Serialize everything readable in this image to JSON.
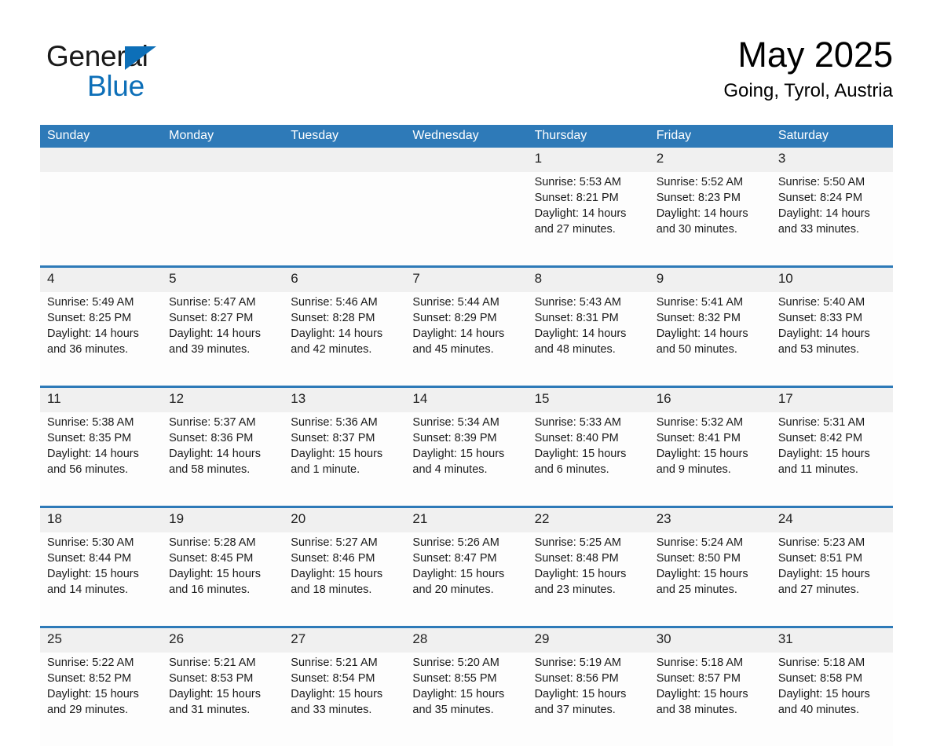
{
  "logo": {
    "word_dark": "General",
    "word_blue": "Blue",
    "triangle_color": "#0d6fb8"
  },
  "header": {
    "month_title": "May 2025",
    "location": "Going, Tyrol, Austria"
  },
  "theme": {
    "header_blue": "#2e7ab8",
    "row_divider_blue": "#2e7ab8",
    "daynum_band": "#f0f0f0",
    "cell_background": "#fdfdfd"
  },
  "calendar": {
    "weekday_headers": [
      "Sunday",
      "Monday",
      "Tuesday",
      "Wednesday",
      "Thursday",
      "Friday",
      "Saturday"
    ],
    "weeks": [
      [
        {
          "day": "",
          "lines": []
        },
        {
          "day": "",
          "lines": []
        },
        {
          "day": "",
          "lines": []
        },
        {
          "day": "",
          "lines": []
        },
        {
          "day": "1",
          "lines": [
            "Sunrise: 5:53 AM",
            "Sunset: 8:21 PM",
            "Daylight: 14 hours",
            "and 27 minutes."
          ]
        },
        {
          "day": "2",
          "lines": [
            "Sunrise: 5:52 AM",
            "Sunset: 8:23 PM",
            "Daylight: 14 hours",
            "and 30 minutes."
          ]
        },
        {
          "day": "3",
          "lines": [
            "Sunrise: 5:50 AM",
            "Sunset: 8:24 PM",
            "Daylight: 14 hours",
            "and 33 minutes."
          ]
        }
      ],
      [
        {
          "day": "4",
          "lines": [
            "Sunrise: 5:49 AM",
            "Sunset: 8:25 PM",
            "Daylight: 14 hours",
            "and 36 minutes."
          ]
        },
        {
          "day": "5",
          "lines": [
            "Sunrise: 5:47 AM",
            "Sunset: 8:27 PM",
            "Daylight: 14 hours",
            "and 39 minutes."
          ]
        },
        {
          "day": "6",
          "lines": [
            "Sunrise: 5:46 AM",
            "Sunset: 8:28 PM",
            "Daylight: 14 hours",
            "and 42 minutes."
          ]
        },
        {
          "day": "7",
          "lines": [
            "Sunrise: 5:44 AM",
            "Sunset: 8:29 PM",
            "Daylight: 14 hours",
            "and 45 minutes."
          ]
        },
        {
          "day": "8",
          "lines": [
            "Sunrise: 5:43 AM",
            "Sunset: 8:31 PM",
            "Daylight: 14 hours",
            "and 48 minutes."
          ]
        },
        {
          "day": "9",
          "lines": [
            "Sunrise: 5:41 AM",
            "Sunset: 8:32 PM",
            "Daylight: 14 hours",
            "and 50 minutes."
          ]
        },
        {
          "day": "10",
          "lines": [
            "Sunrise: 5:40 AM",
            "Sunset: 8:33 PM",
            "Daylight: 14 hours",
            "and 53 minutes."
          ]
        }
      ],
      [
        {
          "day": "11",
          "lines": [
            "Sunrise: 5:38 AM",
            "Sunset: 8:35 PM",
            "Daylight: 14 hours",
            "and 56 minutes."
          ]
        },
        {
          "day": "12",
          "lines": [
            "Sunrise: 5:37 AM",
            "Sunset: 8:36 PM",
            "Daylight: 14 hours",
            "and 58 minutes."
          ]
        },
        {
          "day": "13",
          "lines": [
            "Sunrise: 5:36 AM",
            "Sunset: 8:37 PM",
            "Daylight: 15 hours",
            "and 1 minute."
          ]
        },
        {
          "day": "14",
          "lines": [
            "Sunrise: 5:34 AM",
            "Sunset: 8:39 PM",
            "Daylight: 15 hours",
            "and 4 minutes."
          ]
        },
        {
          "day": "15",
          "lines": [
            "Sunrise: 5:33 AM",
            "Sunset: 8:40 PM",
            "Daylight: 15 hours",
            "and 6 minutes."
          ]
        },
        {
          "day": "16",
          "lines": [
            "Sunrise: 5:32 AM",
            "Sunset: 8:41 PM",
            "Daylight: 15 hours",
            "and 9 minutes."
          ]
        },
        {
          "day": "17",
          "lines": [
            "Sunrise: 5:31 AM",
            "Sunset: 8:42 PM",
            "Daylight: 15 hours",
            "and 11 minutes."
          ]
        }
      ],
      [
        {
          "day": "18",
          "lines": [
            "Sunrise: 5:30 AM",
            "Sunset: 8:44 PM",
            "Daylight: 15 hours",
            "and 14 minutes."
          ]
        },
        {
          "day": "19",
          "lines": [
            "Sunrise: 5:28 AM",
            "Sunset: 8:45 PM",
            "Daylight: 15 hours",
            "and 16 minutes."
          ]
        },
        {
          "day": "20",
          "lines": [
            "Sunrise: 5:27 AM",
            "Sunset: 8:46 PM",
            "Daylight: 15 hours",
            "and 18 minutes."
          ]
        },
        {
          "day": "21",
          "lines": [
            "Sunrise: 5:26 AM",
            "Sunset: 8:47 PM",
            "Daylight: 15 hours",
            "and 20 minutes."
          ]
        },
        {
          "day": "22",
          "lines": [
            "Sunrise: 5:25 AM",
            "Sunset: 8:48 PM",
            "Daylight: 15 hours",
            "and 23 minutes."
          ]
        },
        {
          "day": "23",
          "lines": [
            "Sunrise: 5:24 AM",
            "Sunset: 8:50 PM",
            "Daylight: 15 hours",
            "and 25 minutes."
          ]
        },
        {
          "day": "24",
          "lines": [
            "Sunrise: 5:23 AM",
            "Sunset: 8:51 PM",
            "Daylight: 15 hours",
            "and 27 minutes."
          ]
        }
      ],
      [
        {
          "day": "25",
          "lines": [
            "Sunrise: 5:22 AM",
            "Sunset: 8:52 PM",
            "Daylight: 15 hours",
            "and 29 minutes."
          ]
        },
        {
          "day": "26",
          "lines": [
            "Sunrise: 5:21 AM",
            "Sunset: 8:53 PM",
            "Daylight: 15 hours",
            "and 31 minutes."
          ]
        },
        {
          "day": "27",
          "lines": [
            "Sunrise: 5:21 AM",
            "Sunset: 8:54 PM",
            "Daylight: 15 hours",
            "and 33 minutes."
          ]
        },
        {
          "day": "28",
          "lines": [
            "Sunrise: 5:20 AM",
            "Sunset: 8:55 PM",
            "Daylight: 15 hours",
            "and 35 minutes."
          ]
        },
        {
          "day": "29",
          "lines": [
            "Sunrise: 5:19 AM",
            "Sunset: 8:56 PM",
            "Daylight: 15 hours",
            "and 37 minutes."
          ]
        },
        {
          "day": "30",
          "lines": [
            "Sunrise: 5:18 AM",
            "Sunset: 8:57 PM",
            "Daylight: 15 hours",
            "and 38 minutes."
          ]
        },
        {
          "day": "31",
          "lines": [
            "Sunrise: 5:18 AM",
            "Sunset: 8:58 PM",
            "Daylight: 15 hours",
            "and 40 minutes."
          ]
        }
      ]
    ]
  }
}
